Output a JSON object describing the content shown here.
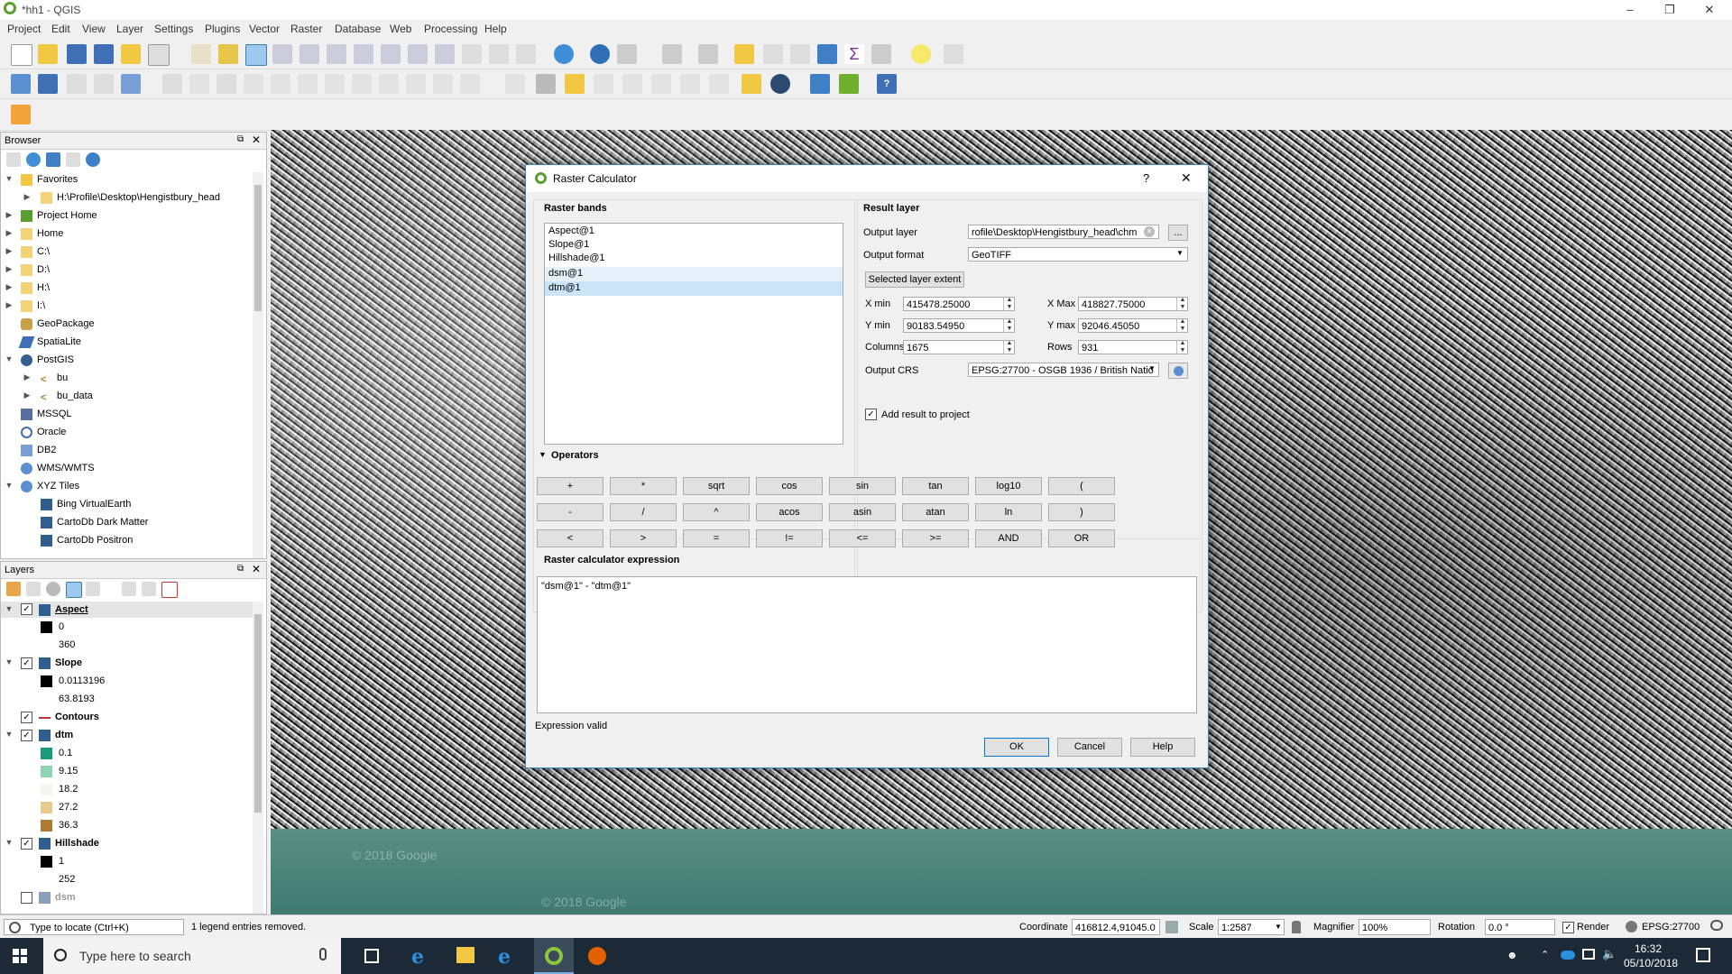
{
  "app": {
    "title": "*hh1 - QGIS"
  },
  "menu": [
    "Project",
    "Edit",
    "View",
    "Layer",
    "Settings",
    "Plugins",
    "Vector",
    "Raster",
    "Database",
    "Web",
    "Processing",
    "Help"
  ],
  "browser": {
    "title": "Browser",
    "items": [
      {
        "label": "Favorites"
      },
      {
        "label": "H:\\Profile\\Desktop\\Hengistbury_head"
      },
      {
        "label": "Project Home"
      },
      {
        "label": "Home"
      },
      {
        "label": "C:\\"
      },
      {
        "label": "D:\\"
      },
      {
        "label": "H:\\"
      },
      {
        "label": "I:\\"
      },
      {
        "label": "GeoPackage"
      },
      {
        "label": "SpatiaLite"
      },
      {
        "label": "PostGIS"
      },
      {
        "label": "bu"
      },
      {
        "label": "bu_data"
      },
      {
        "label": "MSSQL"
      },
      {
        "label": "Oracle"
      },
      {
        "label": "DB2"
      },
      {
        "label": "WMS/WMTS"
      },
      {
        "label": "XYZ Tiles"
      },
      {
        "label": "Bing VirtualEarth"
      },
      {
        "label": "CartoDb Dark Matter"
      },
      {
        "label": "CartoDb Positron"
      }
    ]
  },
  "layers": {
    "title": "Layers",
    "items": [
      {
        "label": "Aspect"
      },
      {
        "label": "0"
      },
      {
        "label": "360"
      },
      {
        "label": "Slope"
      },
      {
        "label": "0.0113196"
      },
      {
        "label": "63.8193"
      },
      {
        "label": "Contours"
      },
      {
        "label": "dtm"
      },
      {
        "label": "0.1"
      },
      {
        "label": "9.15"
      },
      {
        "label": "18.2"
      },
      {
        "label": "27.2"
      },
      {
        "label": "36.3"
      },
      {
        "label": "Hillshade"
      },
      {
        "label": "1"
      },
      {
        "label": "252"
      },
      {
        "label": "dsm"
      }
    ]
  },
  "dialog": {
    "title": "Raster Calculator",
    "help_glyph": "?",
    "close_glyph": "✕",
    "raster_bands_label": "Raster bands",
    "bands": [
      "Aspect@1",
      "Slope@1",
      "Hillshade@1",
      "dsm@1",
      "dtm@1"
    ],
    "result_layer_label": "Result layer",
    "output_layer_label": "Output layer",
    "output_layer_value": "rofile\\Desktop\\Hengistbury_head\\chm",
    "browse_label": "...",
    "output_format_label": "Output format",
    "output_format_value": "GeoTIFF",
    "selected_extent_label": "Selected layer extent",
    "xmin_label": "X min",
    "xmin_value": "415478.25000",
    "xmax_label": "X Max",
    "xmax_value": "418827.75000",
    "ymin_label": "Y min",
    "ymin_value": "90183.54950",
    "ymax_label": "Y max",
    "ymax_value": "92046.45050",
    "columns_label": "Columns",
    "columns_value": "1675",
    "rows_label": "Rows",
    "rows_value": "931",
    "crs_label": "Output CRS",
    "crs_value": "EPSG:27700 - OSGB 1936 / British Natio",
    "add_result_label": "Add result to project",
    "operators_label": "Operators",
    "operators": [
      [
        "+",
        "*",
        "sqrt",
        "cos",
        "sin",
        "tan",
        "log10",
        "("
      ],
      [
        "-",
        "/",
        "^",
        "acos",
        "asin",
        "atan",
        "ln",
        ")"
      ],
      [
        "<",
        ">",
        "=",
        "!=",
        "<=",
        ">=",
        "AND",
        "OR"
      ]
    ],
    "expression_label": "Raster calculator expression",
    "expression": "\"dsm@1\" - \"dtm@1\"",
    "status": "Expression valid",
    "ok_label": "OK",
    "cancel_label": "Cancel",
    "help_label": "Help"
  },
  "map": {
    "watermark1": "© 2018 Google",
    "watermark2": "© 2018 Google"
  },
  "statusbar": {
    "locate_placeholder": "Type to locate (Ctrl+K)",
    "message": "1 legend entries removed.",
    "coordinate_label": "Coordinate",
    "coordinate_value": "416812.4,91045.0",
    "scale_label": "Scale",
    "scale_value": "1:2587",
    "magnifier_label": "Magnifier",
    "magnifier_value": "100%",
    "rotation_label": "Rotation",
    "rotation_value": "0.0 °",
    "render_label": "Render",
    "crs": "EPSG:27700"
  },
  "taskbar": {
    "search_placeholder": "Type here to search",
    "time": "16:32",
    "date": "05/10/2018"
  },
  "colors": {
    "dtm_ramp": [
      "#1a9c7c",
      "#8fd3b3",
      "#f6f6ee",
      "#e8c98e",
      "#b07a32"
    ]
  }
}
